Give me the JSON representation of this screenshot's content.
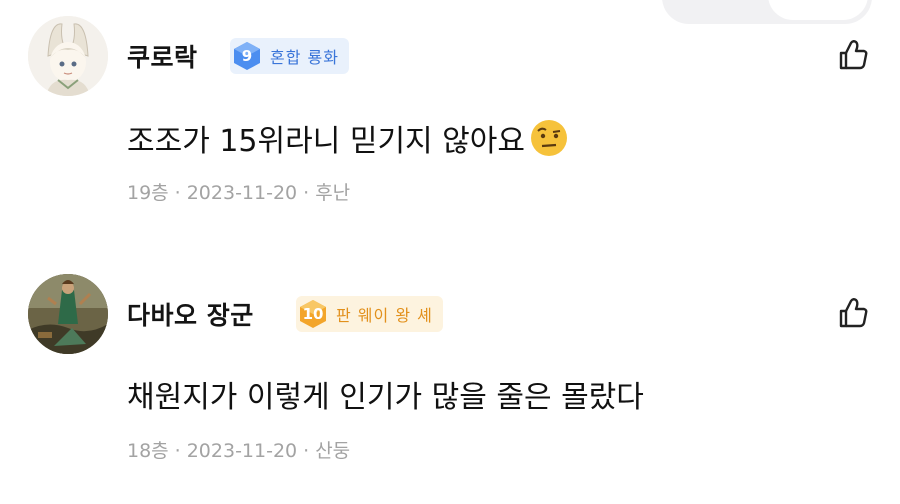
{
  "comments": [
    {
      "username": "쿠로락",
      "level": "9",
      "level_title": "혼합 룡화",
      "text": "조조가 15위라니 믿기지 않아요",
      "emoji": "raised-eyebrow-emoji",
      "floor": "19층",
      "date": "2023-11-20",
      "location": "후난",
      "level_color": "#3a75d9"
    },
    {
      "username": "다바오 장군",
      "level": "10",
      "level_title": "판 웨이 왕 셰",
      "text": "채원지가 이렇게 인기가 많을 줄은 몰랐다",
      "floor": "18층",
      "date": "2023-11-20",
      "location": "산둥",
      "level_color": "#e2901b"
    }
  ],
  "icons": {
    "like": "thumbs-up-outline-icon"
  }
}
